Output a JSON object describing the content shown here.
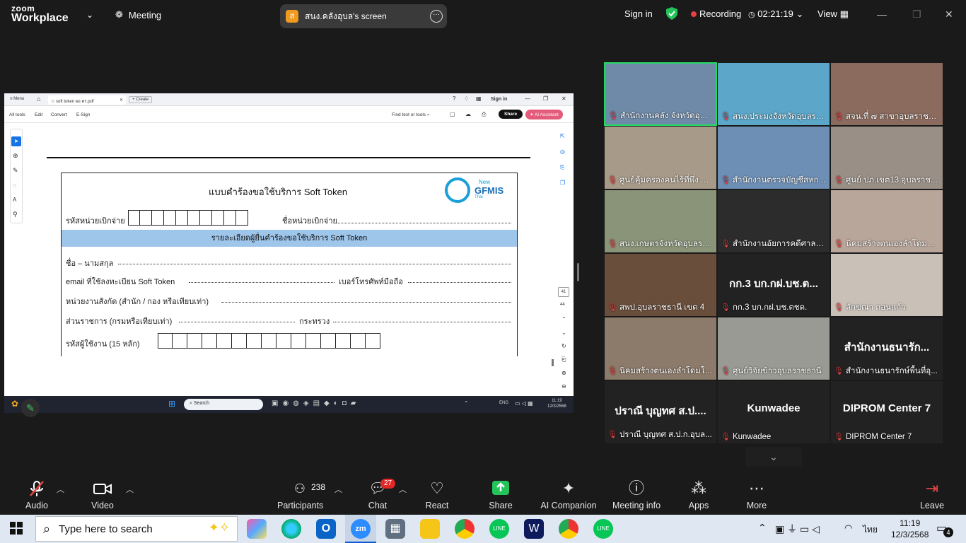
{
  "topbar": {
    "logo_line1": "zoom",
    "logo_line2": "Workplace",
    "meeting_label": "Meeting",
    "screen_avatar": "ส",
    "screen_title": "สนง.คลังอุบล's screen",
    "sign_in": "Sign in",
    "recording": "Recording",
    "timer": "02:21:19",
    "view": "View"
  },
  "shared": {
    "acrobat": {
      "menu": "Menu",
      "tab": "soft token ผอ ตร.pdf",
      "create": "+ Create",
      "sign_in": "Sign in",
      "menu_items": [
        "All tools",
        "Edit",
        "Convert",
        "E-Sign"
      ],
      "find": "Find text or tools",
      "share": "Share",
      "ai": "AI Assistant",
      "page_num": "41",
      "page_total": "44"
    },
    "form": {
      "title": "แบบคำร้องขอใช้บริการ Soft Token",
      "logo_new": "New",
      "logo_text": "GFMIS",
      "logo_thai": "Thai",
      "code_label": "รหัสหน่วยเบิกจ่าย",
      "unit_name_label": "ชื่อหน่วยเบิกจ่าย",
      "banner": "รายละเอียดผู้ยื่นคำร้องขอใช้บริการ Soft Token",
      "name_label": "ชื่อ – นามสกุล",
      "email_label": "email ที่ใช้ลงทะเบียน Soft Token",
      "phone_label": "เบอร์โทรศัพท์มือถือ",
      "dept_label": "หน่วยงานสังกัด (สำนัก / กอง หรือเทียบเท่า)",
      "gov_label": "ส่วนราชการ (กรมหรือเทียบเท่า)",
      "ministry_label": "กระทรวง",
      "user_code_label": "รหัสผู้ใช้งาน (15 หลัก)"
    },
    "inner_taskbar": {
      "search": "Search",
      "lang": "ENG",
      "time": "11:19",
      "date": "12/3/2568"
    }
  },
  "gallery": [
    {
      "name": "สำนักงานคลัง จังหวัดอุบลราช...",
      "bg": "#6f8aa8",
      "active": true
    },
    {
      "name": "สนง.ประมงจังหวัดอุบลราช...",
      "bg": "#5ba6c9"
    },
    {
      "name": "สจน.ที่ ๗ สาขาอุบลราชธ...",
      "bg": "#8a6b5e"
    },
    {
      "name": "ศูนย์คุ้มครองคนไร้ที่พึ่ง จัง...",
      "bg": "#a89a88"
    },
    {
      "name": "สำนักงานตรวจบัญชีสหก...",
      "bg": "#6d8fb5"
    },
    {
      "name": "ศูนย์ ปภ.เขต13 อุบลราช...",
      "bg": "#9a8f86"
    },
    {
      "name": "สนง.เกษตรจังหวัดอุบลรา...",
      "bg": "#8a9479"
    },
    {
      "name": "สำนักงานอัยการคดีศาลแ...",
      "bg": "#2c2c2c"
    },
    {
      "name": "นิคมสร้างตนเองลำโดมน้อ...",
      "bg": "#b9a69a"
    },
    {
      "name": "สพป.อุบลราชธานี เขต 4",
      "bg": "#6a4e3c"
    },
    {
      "name": "กก.3 บก.กฝ.บช.ตชด.",
      "bg": "#222222",
      "center": "กก.3 บก.กฝ.บช.ต..."
    },
    {
      "name": "ลักขณา ถอนแก้ว",
      "bg": "#c9c1b8"
    },
    {
      "name": "นิคมสร้างตนเองลำโดมใหญ่",
      "bg": "#8c7a6a"
    },
    {
      "name": "ศูนย์วิจัยข้าวอุบลราชธานี",
      "bg": "#9a9a94"
    },
    {
      "name": "สำนักงานธนารักษ์พื้นที่อุ...",
      "bg": "#222222",
      "center": "สำนักงานธนารัก..."
    },
    {
      "name": "ปราณี บุญทศ ส.ป.ก.อุบล...",
      "bg": "#222222",
      "center": "ปราณี บุญทศ ส.ป...."
    },
    {
      "name": "Kunwadee",
      "bg": "#222222",
      "center": "Kunwadee"
    },
    {
      "name": "DIPROM Center 7",
      "bg": "#222222",
      "center": "DIPROM Center 7"
    }
  ],
  "toolbar": {
    "audio": "Audio",
    "video": "Video",
    "participants": "Participants",
    "participants_count": "238",
    "chat": "Chat",
    "chat_badge": "27",
    "react": "React",
    "share": "Share",
    "ai_companion": "AI Companion",
    "meeting_info": "Meeting info",
    "apps": "Apps",
    "more": "More",
    "leave": "Leave"
  },
  "taskbar": {
    "search_placeholder": "Type here to search",
    "lang": "ไทย",
    "time": "11:19",
    "date": "12/3/2568",
    "notif": "4"
  }
}
